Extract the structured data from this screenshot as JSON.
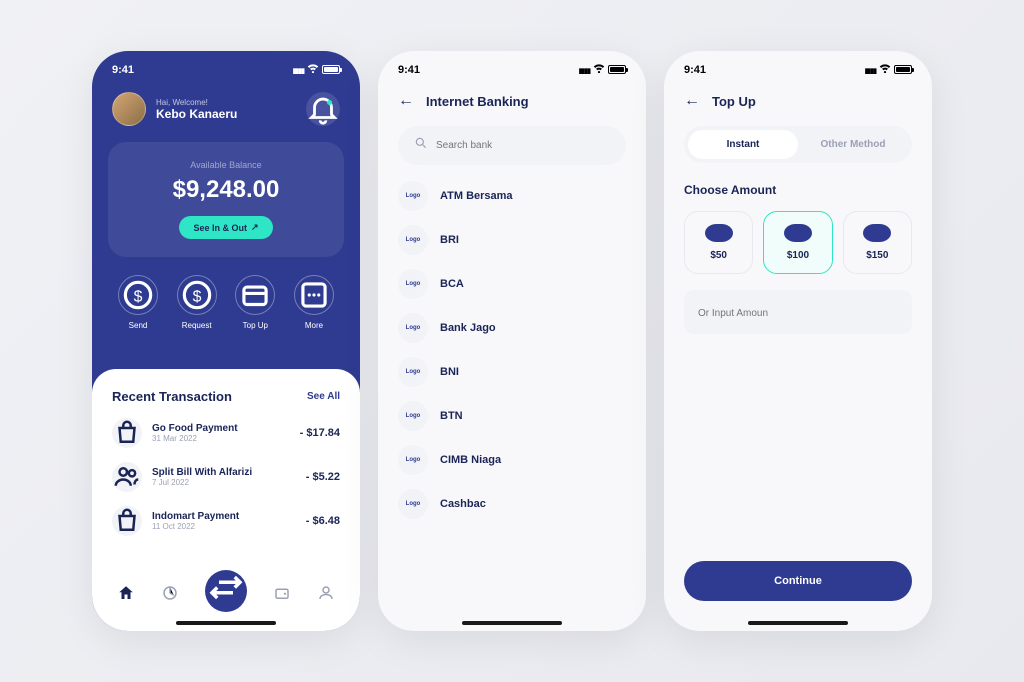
{
  "status": {
    "time": "9:41"
  },
  "screen1": {
    "greeting": "Hai, Welcome!",
    "username": "Kebo Kanaeru",
    "balance_label": "Available Balance",
    "balance": "$9,248.00",
    "see_btn": "See In & Out",
    "actions": [
      {
        "icon": "send",
        "label": "Send"
      },
      {
        "icon": "request",
        "label": "Request"
      },
      {
        "icon": "topup",
        "label": "Top Up"
      },
      {
        "icon": "more",
        "label": "More"
      }
    ],
    "recent_title": "Recent Transaction",
    "see_all": "See All",
    "transactions": [
      {
        "name": "Go Food Payment",
        "date": "31 Mar 2022",
        "amount": "- $17.84"
      },
      {
        "name": "Split Bill With Alfarizi",
        "date": "7 Jul 2022",
        "amount": "- $5.22"
      },
      {
        "name": "Indomart Payment",
        "date": "11 Oct 2022",
        "amount": "- $6.48"
      }
    ]
  },
  "screen2": {
    "title": "Internet Banking",
    "search_placeholder": "Search bank",
    "logo_text": "Logo",
    "banks": [
      "ATM Bersama",
      "BRI",
      "BCA",
      "Bank Jago",
      "BNI",
      "BTN",
      "CIMB Niaga",
      "Cashbac"
    ]
  },
  "screen3": {
    "title": "Top Up",
    "tabs": [
      "Instant",
      "Other Method"
    ],
    "choose_title": "Choose Amount",
    "amounts": [
      "$50",
      "$100",
      "$150"
    ],
    "input_placeholder": "Or Input Amoun",
    "continue": "Continue"
  }
}
